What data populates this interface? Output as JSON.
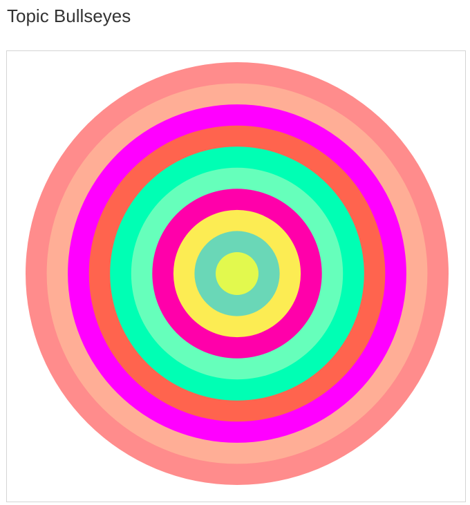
{
  "page": {
    "title": "Topic Bullseyes"
  },
  "chart_data": {
    "type": "bullseye",
    "rings_outer_to_inner": [
      {
        "color": "#ff8c8c"
      },
      {
        "color": "#ffae96"
      },
      {
        "color": "#ff00ff"
      },
      {
        "color": "#ff644e"
      },
      {
        "color": "#00ffb4"
      },
      {
        "color": "#66ffbb"
      },
      {
        "color": "#ff00aa"
      },
      {
        "color": "#fcec53"
      },
      {
        "color": "#6ad7b7"
      },
      {
        "color": "#e2f94e"
      }
    ]
  }
}
